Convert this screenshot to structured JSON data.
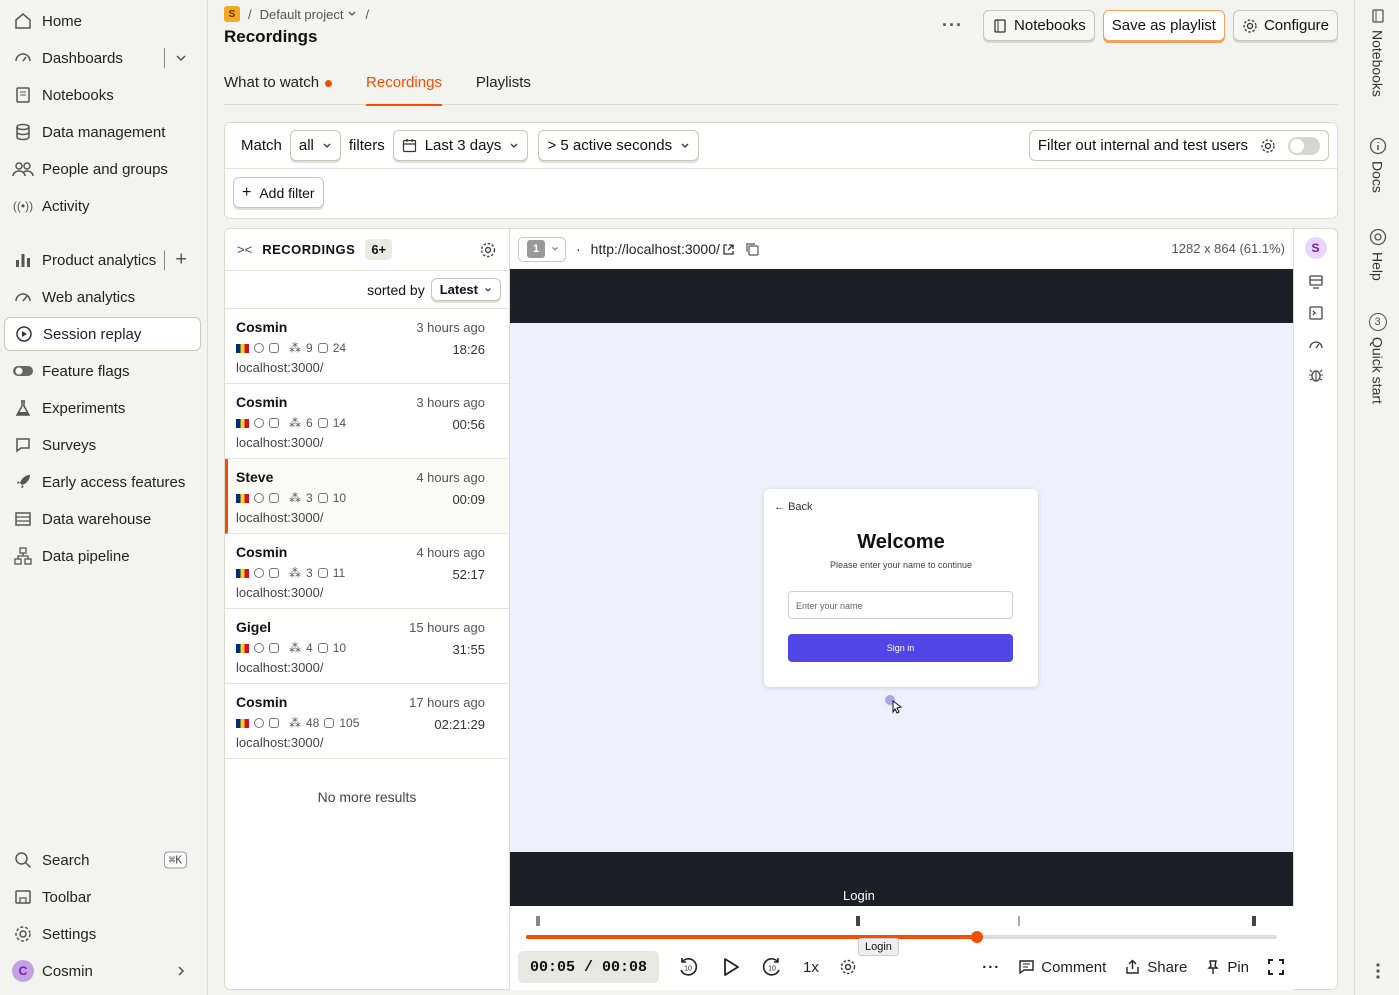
{
  "sidebar": {
    "items": [
      {
        "label": "Home"
      },
      {
        "label": "Dashboards"
      },
      {
        "label": "Notebooks"
      },
      {
        "label": "Data management"
      },
      {
        "label": "People and groups"
      },
      {
        "label": "Activity"
      },
      {
        "label": "Product analytics"
      },
      {
        "label": "Web analytics"
      },
      {
        "label": "Session replay"
      },
      {
        "label": "Feature flags"
      },
      {
        "label": "Experiments"
      },
      {
        "label": "Surveys"
      },
      {
        "label": "Early access features"
      },
      {
        "label": "Data warehouse"
      },
      {
        "label": "Data pipeline"
      }
    ],
    "bottom": {
      "search": "Search",
      "search_shortcut": "⌘K",
      "toolbar": "Toolbar",
      "settings": "Settings",
      "user": "Cosmin",
      "user_initial": "C"
    }
  },
  "header": {
    "project_initial": "S",
    "project": "Default project",
    "separator": "/",
    "title": "Recordings",
    "more": "···",
    "notebooks": "Notebooks",
    "save_playlist": "Save as playlist",
    "configure": "Configure"
  },
  "tabs": [
    {
      "label": "What to watch"
    },
    {
      "label": "Recordings"
    },
    {
      "label": "Playlists"
    }
  ],
  "filters": {
    "match_label": "Match",
    "match_value": "all",
    "filters_label": "filters",
    "date_range": "Last 3 days",
    "duration": "> 5 active seconds",
    "internal_label": "Filter out internal and test users",
    "add_filter": "Add filter"
  },
  "recordings": {
    "header": "RECORDINGS",
    "count": "6+",
    "sorted_by": "sorted by",
    "sort_value": "Latest",
    "items": [
      {
        "name": "Cosmin",
        "ago": "3 hours ago",
        "clicks": "9",
        "keys": "24",
        "duration": "18:26",
        "url": "localhost:3000/"
      },
      {
        "name": "Cosmin",
        "ago": "3 hours ago",
        "clicks": "6",
        "keys": "14",
        "duration": "00:56",
        "url": "localhost:3000/"
      },
      {
        "name": "Steve",
        "ago": "4 hours ago",
        "clicks": "3",
        "keys": "10",
        "duration": "00:09",
        "url": "localhost:3000/"
      },
      {
        "name": "Cosmin",
        "ago": "4 hours ago",
        "clicks": "3",
        "keys": "11",
        "duration": "52:17",
        "url": "localhost:3000/"
      },
      {
        "name": "Gigel",
        "ago": "15 hours ago",
        "clicks": "4",
        "keys": "10",
        "duration": "31:55",
        "url": "localhost:3000/"
      },
      {
        "name": "Cosmin",
        "ago": "17 hours ago",
        "clicks": "48",
        "keys": "105",
        "duration": "02:21:29",
        "url": "localhost:3000/"
      }
    ],
    "no_more": "No more results"
  },
  "player": {
    "window_number": "1",
    "dot": "·",
    "url": "http://localhost:3000/",
    "resolution": "1282 x 864 (61.1%)",
    "user_initial": "S",
    "page": {
      "back": "Back",
      "title": "Welcome",
      "subtitle": "Please enter your name to continue",
      "input_placeholder": "Enter your name",
      "button": "Sign in"
    },
    "tooltip": "Login",
    "event_label": "Login",
    "progress_fraction": 0.6,
    "time": "00:05 / 00:08",
    "speed": "1x",
    "more": "···",
    "comment": "Comment",
    "share": "Share",
    "pin": "Pin"
  },
  "rightbar": {
    "notebooks": "Notebooks",
    "docs": "Docs",
    "help": "Help",
    "quickstart_count": "3",
    "quickstart": "Quick start"
  },
  "colors": {
    "accent": "#f54e00",
    "brand_button": "#4f46e5"
  }
}
